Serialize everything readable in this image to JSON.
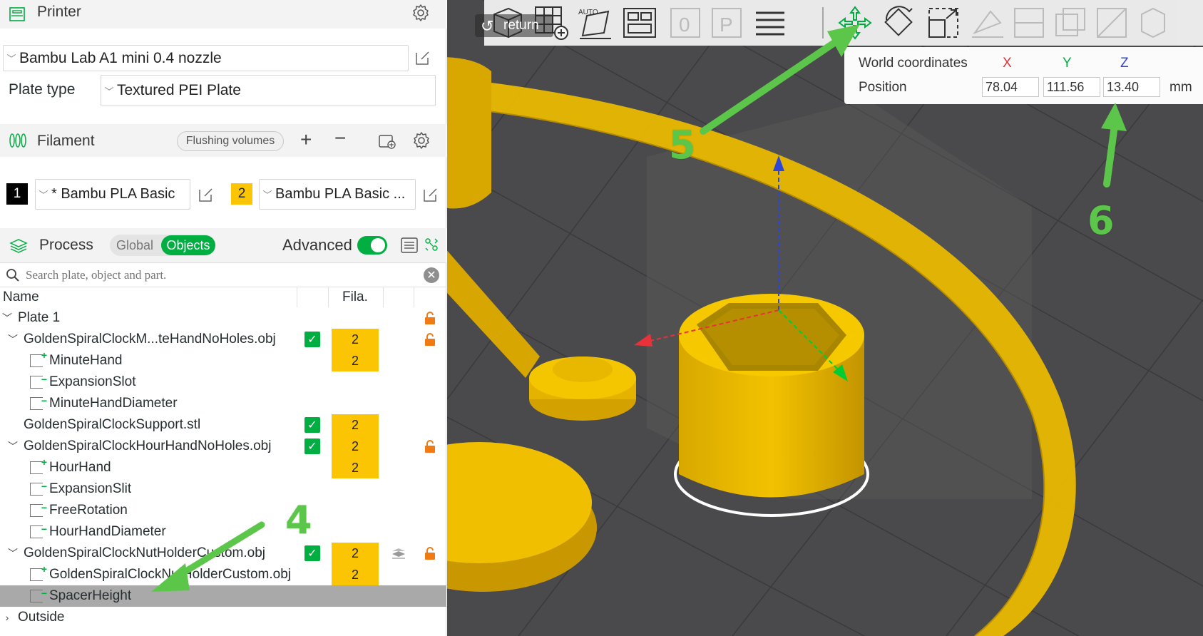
{
  "printer": {
    "title": "Printer",
    "selected_printer": "Bambu Lab A1 mini 0.4 nozzle",
    "plate_type_label": "Plate type",
    "plate_type_value": "Textured PEI Plate"
  },
  "filament": {
    "title": "Filament",
    "flushing_label": "Flushing volumes",
    "slots": [
      {
        "number": "1",
        "name": "* Bambu PLA Basic",
        "color": "#000000"
      },
      {
        "number": "2",
        "name": "Bambu PLA Basic ...",
        "color": "#fcc503"
      }
    ]
  },
  "process": {
    "title": "Process",
    "global_label": "Global",
    "objects_label": "Objects",
    "advanced_label": "Advanced",
    "advanced_on": true
  },
  "search": {
    "placeholder": "Search plate, object and part."
  },
  "tree": {
    "col_name": "Name",
    "col_fila": "Fila.",
    "plate": "Plate 1",
    "rows": [
      {
        "label": "GoldenSpiralClockM...teHandNoHoles.obj",
        "fila": "2"
      },
      {
        "label": "MinuteHand",
        "fila": "2"
      },
      {
        "label": "ExpansionSlot"
      },
      {
        "label": "MinuteHandDiameter"
      },
      {
        "label": "GoldenSpiralClockSupport.stl",
        "fila": "2"
      },
      {
        "label": "GoldenSpiralClockHourHandNoHoles.obj",
        "fila": "2"
      },
      {
        "label": "HourHand",
        "fila": "2"
      },
      {
        "label": "ExpansionSlit"
      },
      {
        "label": "FreeRotation"
      },
      {
        "label": "HourHandDiameter"
      },
      {
        "label": "GoldenSpiralClockNutHolderCustom.obj",
        "fila": "2"
      },
      {
        "label": "GoldenSpiralClockNutHolderCustom.obj",
        "fila": "2"
      },
      {
        "label": "SpacerHeight"
      }
    ],
    "outside": "Outside"
  },
  "toolbar": {
    "return_label": "return",
    "auto_label": "AUTO"
  },
  "coords": {
    "title": "World coordinates",
    "x_label": "X",
    "y_label": "Y",
    "z_label": "Z",
    "position_label": "Position",
    "x": "78.04",
    "y": "111.56",
    "z": "13.40",
    "unit": "mm",
    "x_color": "#e8323a",
    "y_color": "#00ae42",
    "z_color": "#2d46d6"
  },
  "annotations": {
    "a4": "4",
    "a5": "5",
    "a6": "6",
    "color": "#5cc64a"
  }
}
